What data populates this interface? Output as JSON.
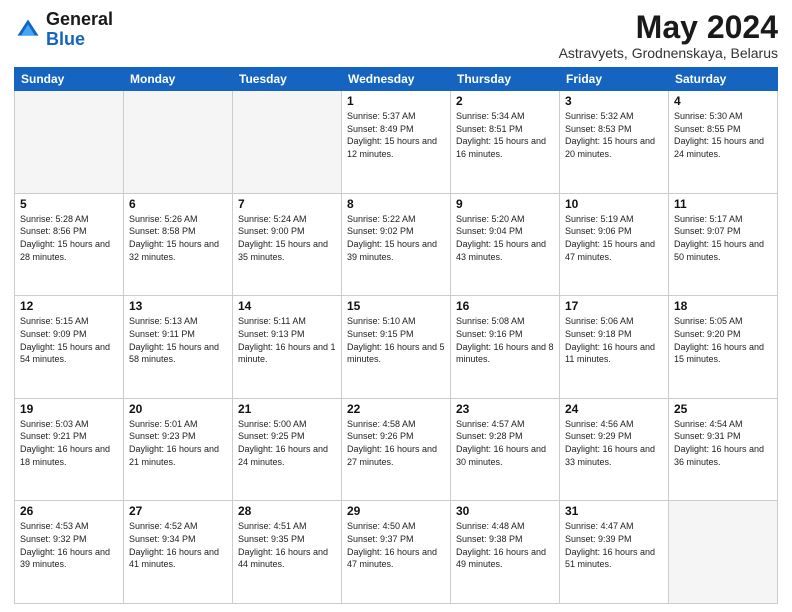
{
  "logo": {
    "general": "General",
    "blue": "Blue"
  },
  "header": {
    "title": "May 2024",
    "subtitle": "Astravyets, Grodnenskaya, Belarus"
  },
  "days_of_week": [
    "Sunday",
    "Monday",
    "Tuesday",
    "Wednesday",
    "Thursday",
    "Friday",
    "Saturday"
  ],
  "weeks": [
    [
      {
        "day": "",
        "sunrise": "",
        "sunset": "",
        "daylight": "",
        "empty": true
      },
      {
        "day": "",
        "sunrise": "",
        "sunset": "",
        "daylight": "",
        "empty": true
      },
      {
        "day": "",
        "sunrise": "",
        "sunset": "",
        "daylight": "",
        "empty": true
      },
      {
        "day": "1",
        "sunrise": "Sunrise: 5:37 AM",
        "sunset": "Sunset: 8:49 PM",
        "daylight": "Daylight: 15 hours and 12 minutes.",
        "empty": false
      },
      {
        "day": "2",
        "sunrise": "Sunrise: 5:34 AM",
        "sunset": "Sunset: 8:51 PM",
        "daylight": "Daylight: 15 hours and 16 minutes.",
        "empty": false
      },
      {
        "day": "3",
        "sunrise": "Sunrise: 5:32 AM",
        "sunset": "Sunset: 8:53 PM",
        "daylight": "Daylight: 15 hours and 20 minutes.",
        "empty": false
      },
      {
        "day": "4",
        "sunrise": "Sunrise: 5:30 AM",
        "sunset": "Sunset: 8:55 PM",
        "daylight": "Daylight: 15 hours and 24 minutes.",
        "empty": false
      }
    ],
    [
      {
        "day": "5",
        "sunrise": "Sunrise: 5:28 AM",
        "sunset": "Sunset: 8:56 PM",
        "daylight": "Daylight: 15 hours and 28 minutes.",
        "empty": false
      },
      {
        "day": "6",
        "sunrise": "Sunrise: 5:26 AM",
        "sunset": "Sunset: 8:58 PM",
        "daylight": "Daylight: 15 hours and 32 minutes.",
        "empty": false
      },
      {
        "day": "7",
        "sunrise": "Sunrise: 5:24 AM",
        "sunset": "Sunset: 9:00 PM",
        "daylight": "Daylight: 15 hours and 35 minutes.",
        "empty": false
      },
      {
        "day": "8",
        "sunrise": "Sunrise: 5:22 AM",
        "sunset": "Sunset: 9:02 PM",
        "daylight": "Daylight: 15 hours and 39 minutes.",
        "empty": false
      },
      {
        "day": "9",
        "sunrise": "Sunrise: 5:20 AM",
        "sunset": "Sunset: 9:04 PM",
        "daylight": "Daylight: 15 hours and 43 minutes.",
        "empty": false
      },
      {
        "day": "10",
        "sunrise": "Sunrise: 5:19 AM",
        "sunset": "Sunset: 9:06 PM",
        "daylight": "Daylight: 15 hours and 47 minutes.",
        "empty": false
      },
      {
        "day": "11",
        "sunrise": "Sunrise: 5:17 AM",
        "sunset": "Sunset: 9:07 PM",
        "daylight": "Daylight: 15 hours and 50 minutes.",
        "empty": false
      }
    ],
    [
      {
        "day": "12",
        "sunrise": "Sunrise: 5:15 AM",
        "sunset": "Sunset: 9:09 PM",
        "daylight": "Daylight: 15 hours and 54 minutes.",
        "empty": false
      },
      {
        "day": "13",
        "sunrise": "Sunrise: 5:13 AM",
        "sunset": "Sunset: 9:11 PM",
        "daylight": "Daylight: 15 hours and 58 minutes.",
        "empty": false
      },
      {
        "day": "14",
        "sunrise": "Sunrise: 5:11 AM",
        "sunset": "Sunset: 9:13 PM",
        "daylight": "Daylight: 16 hours and 1 minute.",
        "empty": false
      },
      {
        "day": "15",
        "sunrise": "Sunrise: 5:10 AM",
        "sunset": "Sunset: 9:15 PM",
        "daylight": "Daylight: 16 hours and 5 minutes.",
        "empty": false
      },
      {
        "day": "16",
        "sunrise": "Sunrise: 5:08 AM",
        "sunset": "Sunset: 9:16 PM",
        "daylight": "Daylight: 16 hours and 8 minutes.",
        "empty": false
      },
      {
        "day": "17",
        "sunrise": "Sunrise: 5:06 AM",
        "sunset": "Sunset: 9:18 PM",
        "daylight": "Daylight: 16 hours and 11 minutes.",
        "empty": false
      },
      {
        "day": "18",
        "sunrise": "Sunrise: 5:05 AM",
        "sunset": "Sunset: 9:20 PM",
        "daylight": "Daylight: 16 hours and 15 minutes.",
        "empty": false
      }
    ],
    [
      {
        "day": "19",
        "sunrise": "Sunrise: 5:03 AM",
        "sunset": "Sunset: 9:21 PM",
        "daylight": "Daylight: 16 hours and 18 minutes.",
        "empty": false
      },
      {
        "day": "20",
        "sunrise": "Sunrise: 5:01 AM",
        "sunset": "Sunset: 9:23 PM",
        "daylight": "Daylight: 16 hours and 21 minutes.",
        "empty": false
      },
      {
        "day": "21",
        "sunrise": "Sunrise: 5:00 AM",
        "sunset": "Sunset: 9:25 PM",
        "daylight": "Daylight: 16 hours and 24 minutes.",
        "empty": false
      },
      {
        "day": "22",
        "sunrise": "Sunrise: 4:58 AM",
        "sunset": "Sunset: 9:26 PM",
        "daylight": "Daylight: 16 hours and 27 minutes.",
        "empty": false
      },
      {
        "day": "23",
        "sunrise": "Sunrise: 4:57 AM",
        "sunset": "Sunset: 9:28 PM",
        "daylight": "Daylight: 16 hours and 30 minutes.",
        "empty": false
      },
      {
        "day": "24",
        "sunrise": "Sunrise: 4:56 AM",
        "sunset": "Sunset: 9:29 PM",
        "daylight": "Daylight: 16 hours and 33 minutes.",
        "empty": false
      },
      {
        "day": "25",
        "sunrise": "Sunrise: 4:54 AM",
        "sunset": "Sunset: 9:31 PM",
        "daylight": "Daylight: 16 hours and 36 minutes.",
        "empty": false
      }
    ],
    [
      {
        "day": "26",
        "sunrise": "Sunrise: 4:53 AM",
        "sunset": "Sunset: 9:32 PM",
        "daylight": "Daylight: 16 hours and 39 minutes.",
        "empty": false
      },
      {
        "day": "27",
        "sunrise": "Sunrise: 4:52 AM",
        "sunset": "Sunset: 9:34 PM",
        "daylight": "Daylight: 16 hours and 41 minutes.",
        "empty": false
      },
      {
        "day": "28",
        "sunrise": "Sunrise: 4:51 AM",
        "sunset": "Sunset: 9:35 PM",
        "daylight": "Daylight: 16 hours and 44 minutes.",
        "empty": false
      },
      {
        "day": "29",
        "sunrise": "Sunrise: 4:50 AM",
        "sunset": "Sunset: 9:37 PM",
        "daylight": "Daylight: 16 hours and 47 minutes.",
        "empty": false
      },
      {
        "day": "30",
        "sunrise": "Sunrise: 4:48 AM",
        "sunset": "Sunset: 9:38 PM",
        "daylight": "Daylight: 16 hours and 49 minutes.",
        "empty": false
      },
      {
        "day": "31",
        "sunrise": "Sunrise: 4:47 AM",
        "sunset": "Sunset: 9:39 PM",
        "daylight": "Daylight: 16 hours and 51 minutes.",
        "empty": false
      },
      {
        "day": "",
        "sunrise": "",
        "sunset": "",
        "daylight": "",
        "empty": true
      }
    ]
  ]
}
